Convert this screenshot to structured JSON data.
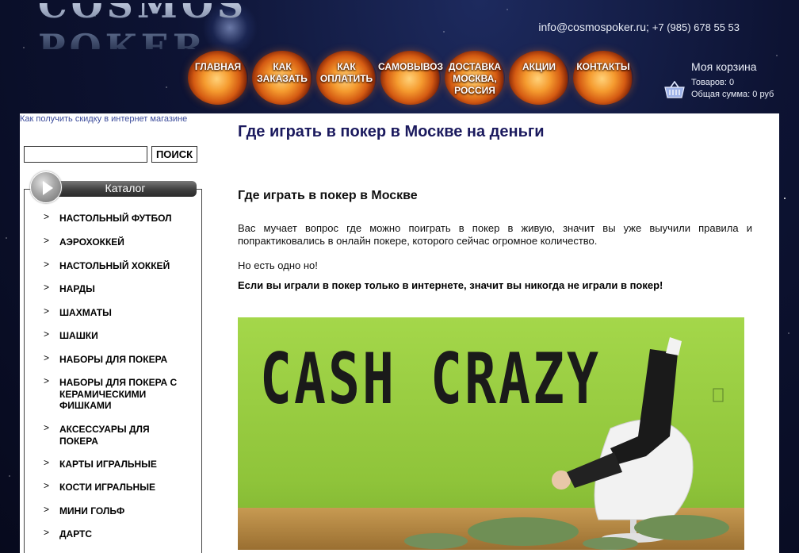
{
  "header": {
    "logo_text": "COSMOS POKER",
    "email": "info@cosmospoker.ru",
    "separator": ";",
    "phone": "+7 (985) 678 55 53"
  },
  "nav": {
    "items": [
      {
        "label": "ГЛАВНАЯ"
      },
      {
        "label": "КАК\nЗАКАЗАТЬ"
      },
      {
        "label": "КАК\nОПЛАТИТЬ"
      },
      {
        "label": "САМОВЫВОЗ"
      },
      {
        "label": "ДОСТАВКА\nМОСКВА,\nРОССИЯ"
      },
      {
        "label": "АКЦИИ"
      },
      {
        "label": "КОНТАКТЫ"
      }
    ]
  },
  "cart": {
    "title": "Моя корзина",
    "items_line": "Товаров: 0",
    "total_line": "Общая сумма: 0 руб"
  },
  "sidebar": {
    "promo_link": "Как получить скидку в интернет магазине",
    "search": {
      "value": "",
      "placeholder": "",
      "button_label": "ПОИСК"
    },
    "catalog_title": "Каталог",
    "arrow": ">",
    "categories": [
      {
        "label": "НАСТОЛЬНЫЙ ФУТБОЛ"
      },
      {
        "label": "АЭРОХОККЕЙ"
      },
      {
        "label": "НАСТОЛЬНЫЙ ХОККЕЙ"
      },
      {
        "label": "НАРДЫ"
      },
      {
        "label": "ШАХМАТЫ"
      },
      {
        "label": "ШАШКИ"
      },
      {
        "label": "НАБОРЫ ДЛЯ ПОКЕРА"
      },
      {
        "label": "НАБОРЫ ДЛЯ ПОКЕРА С КЕРАМИЧЕСКИМИ ФИШКАМИ"
      },
      {
        "label": "АКСЕССУАРЫ ДЛЯ ПОКЕРА"
      },
      {
        "label": "КАРТЫ ИГРАЛЬНЫЕ"
      },
      {
        "label": "КОСТИ ИГРАЛЬНЫЕ"
      },
      {
        "label": "МИНИ ГОЛЬФ"
      },
      {
        "label": "ДАРТС"
      }
    ]
  },
  "article": {
    "title": "Где играть в покер в Москве на деньги",
    "subtitle": "Где играть в покер в Москве",
    "paragraph1": "Вас мучает вопрос где можно поиграть в покер в живую, значит вы уже выучили правила и попрактиковались в онлайн покере, которого сейчас огромное количество.",
    "paragraph2": "Но есть одно но!",
    "paragraph3": "Если вы играли в покер только в интернете, значит вы никогда не играли в покер!",
    "image_text": "CASH CRAZY"
  },
  "colors": {
    "accent_title": "#1b1a5e",
    "link": "#3a4a9a",
    "background": "#0a0f2a",
    "hero_green": "#8fc43a"
  }
}
